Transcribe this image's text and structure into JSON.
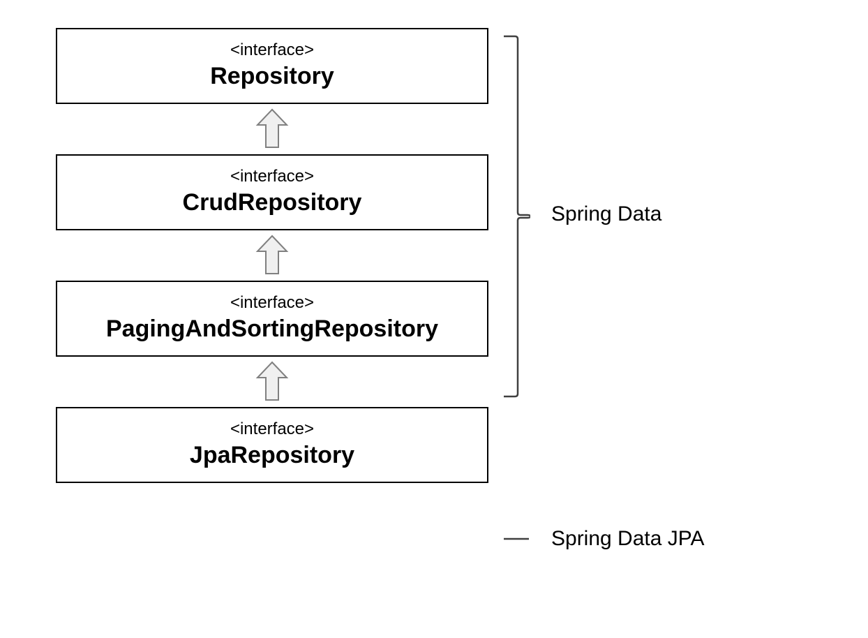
{
  "interfaces": [
    {
      "stereotype": "<interface>",
      "name": "Repository"
    },
    {
      "stereotype": "<interface>",
      "name": "CrudRepository"
    },
    {
      "stereotype": "<interface>",
      "name": "PagingAndSortingRepository"
    },
    {
      "stereotype": "<interface>",
      "name": "JpaRepository"
    }
  ],
  "labels": {
    "group1": "Spring Data",
    "group2": "Spring Data JPA"
  }
}
